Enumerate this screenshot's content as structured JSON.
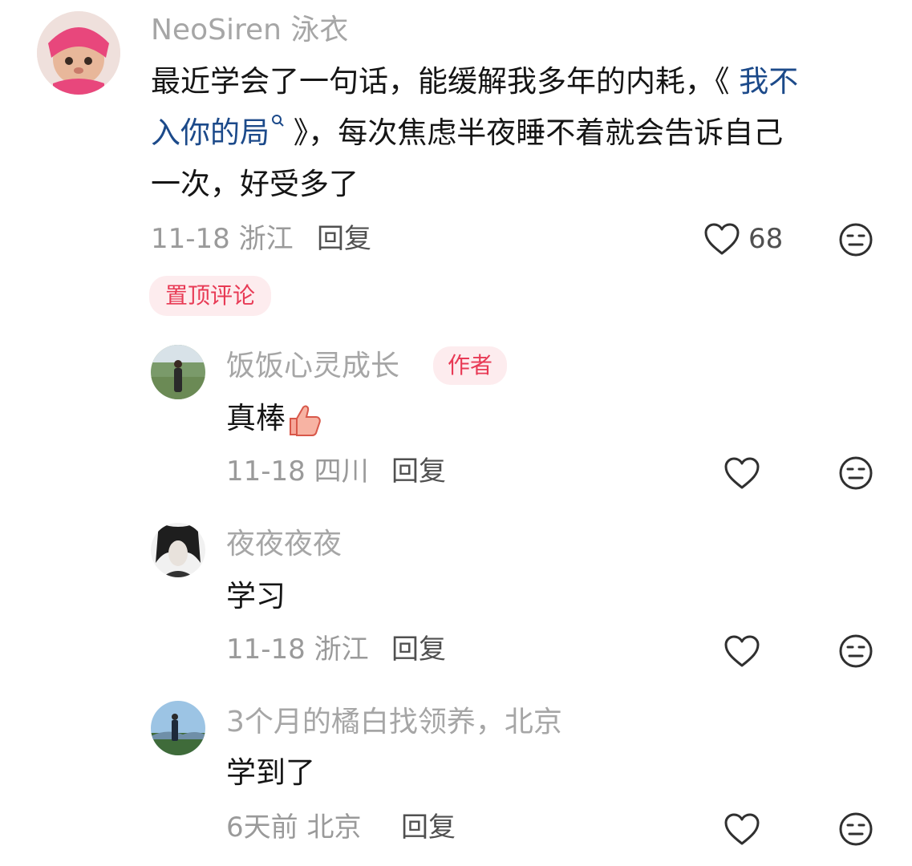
{
  "comments": [
    {
      "username": "NeoSiren 泳衣",
      "body": {
        "line1_pre": "最近学会了一句话，能缓解我多年的内耗，《",
        "line1_link": " 我不",
        "line2_link": "入你的局",
        "line2_post": " 》，每次焦虑半夜睡不着就会告诉自己",
        "line3": "一次，好受多了"
      },
      "date": "11-18",
      "location": "浙江",
      "reply_label": "回复",
      "like_count": "68",
      "pinned_label": "置顶评论"
    },
    {
      "username": "饭饭心灵成长",
      "author_badge": "作者",
      "body": "真棒",
      "date": "11-18",
      "location": "四川",
      "reply_label": "回复"
    },
    {
      "username": "夜夜夜夜",
      "body": "学习",
      "date": "11-18",
      "location": "浙江",
      "reply_label": "回复"
    },
    {
      "username": "3个月的橘白找领养，北京",
      "body": "学到了",
      "date": "6天前",
      "location": "北京",
      "reply_label": "回复"
    }
  ],
  "icons": {
    "like": "heart-outline-icon",
    "dislike": "neutral-face-icon",
    "search": "search-mini-icon",
    "thumbs_up": "thumbs-up-emoji-icon"
  },
  "colors": {
    "accent_red": "#e83a55",
    "pill_bg": "#fdecee",
    "link_blue": "#1c4a8a",
    "username_gray": "#a6a6a6"
  }
}
